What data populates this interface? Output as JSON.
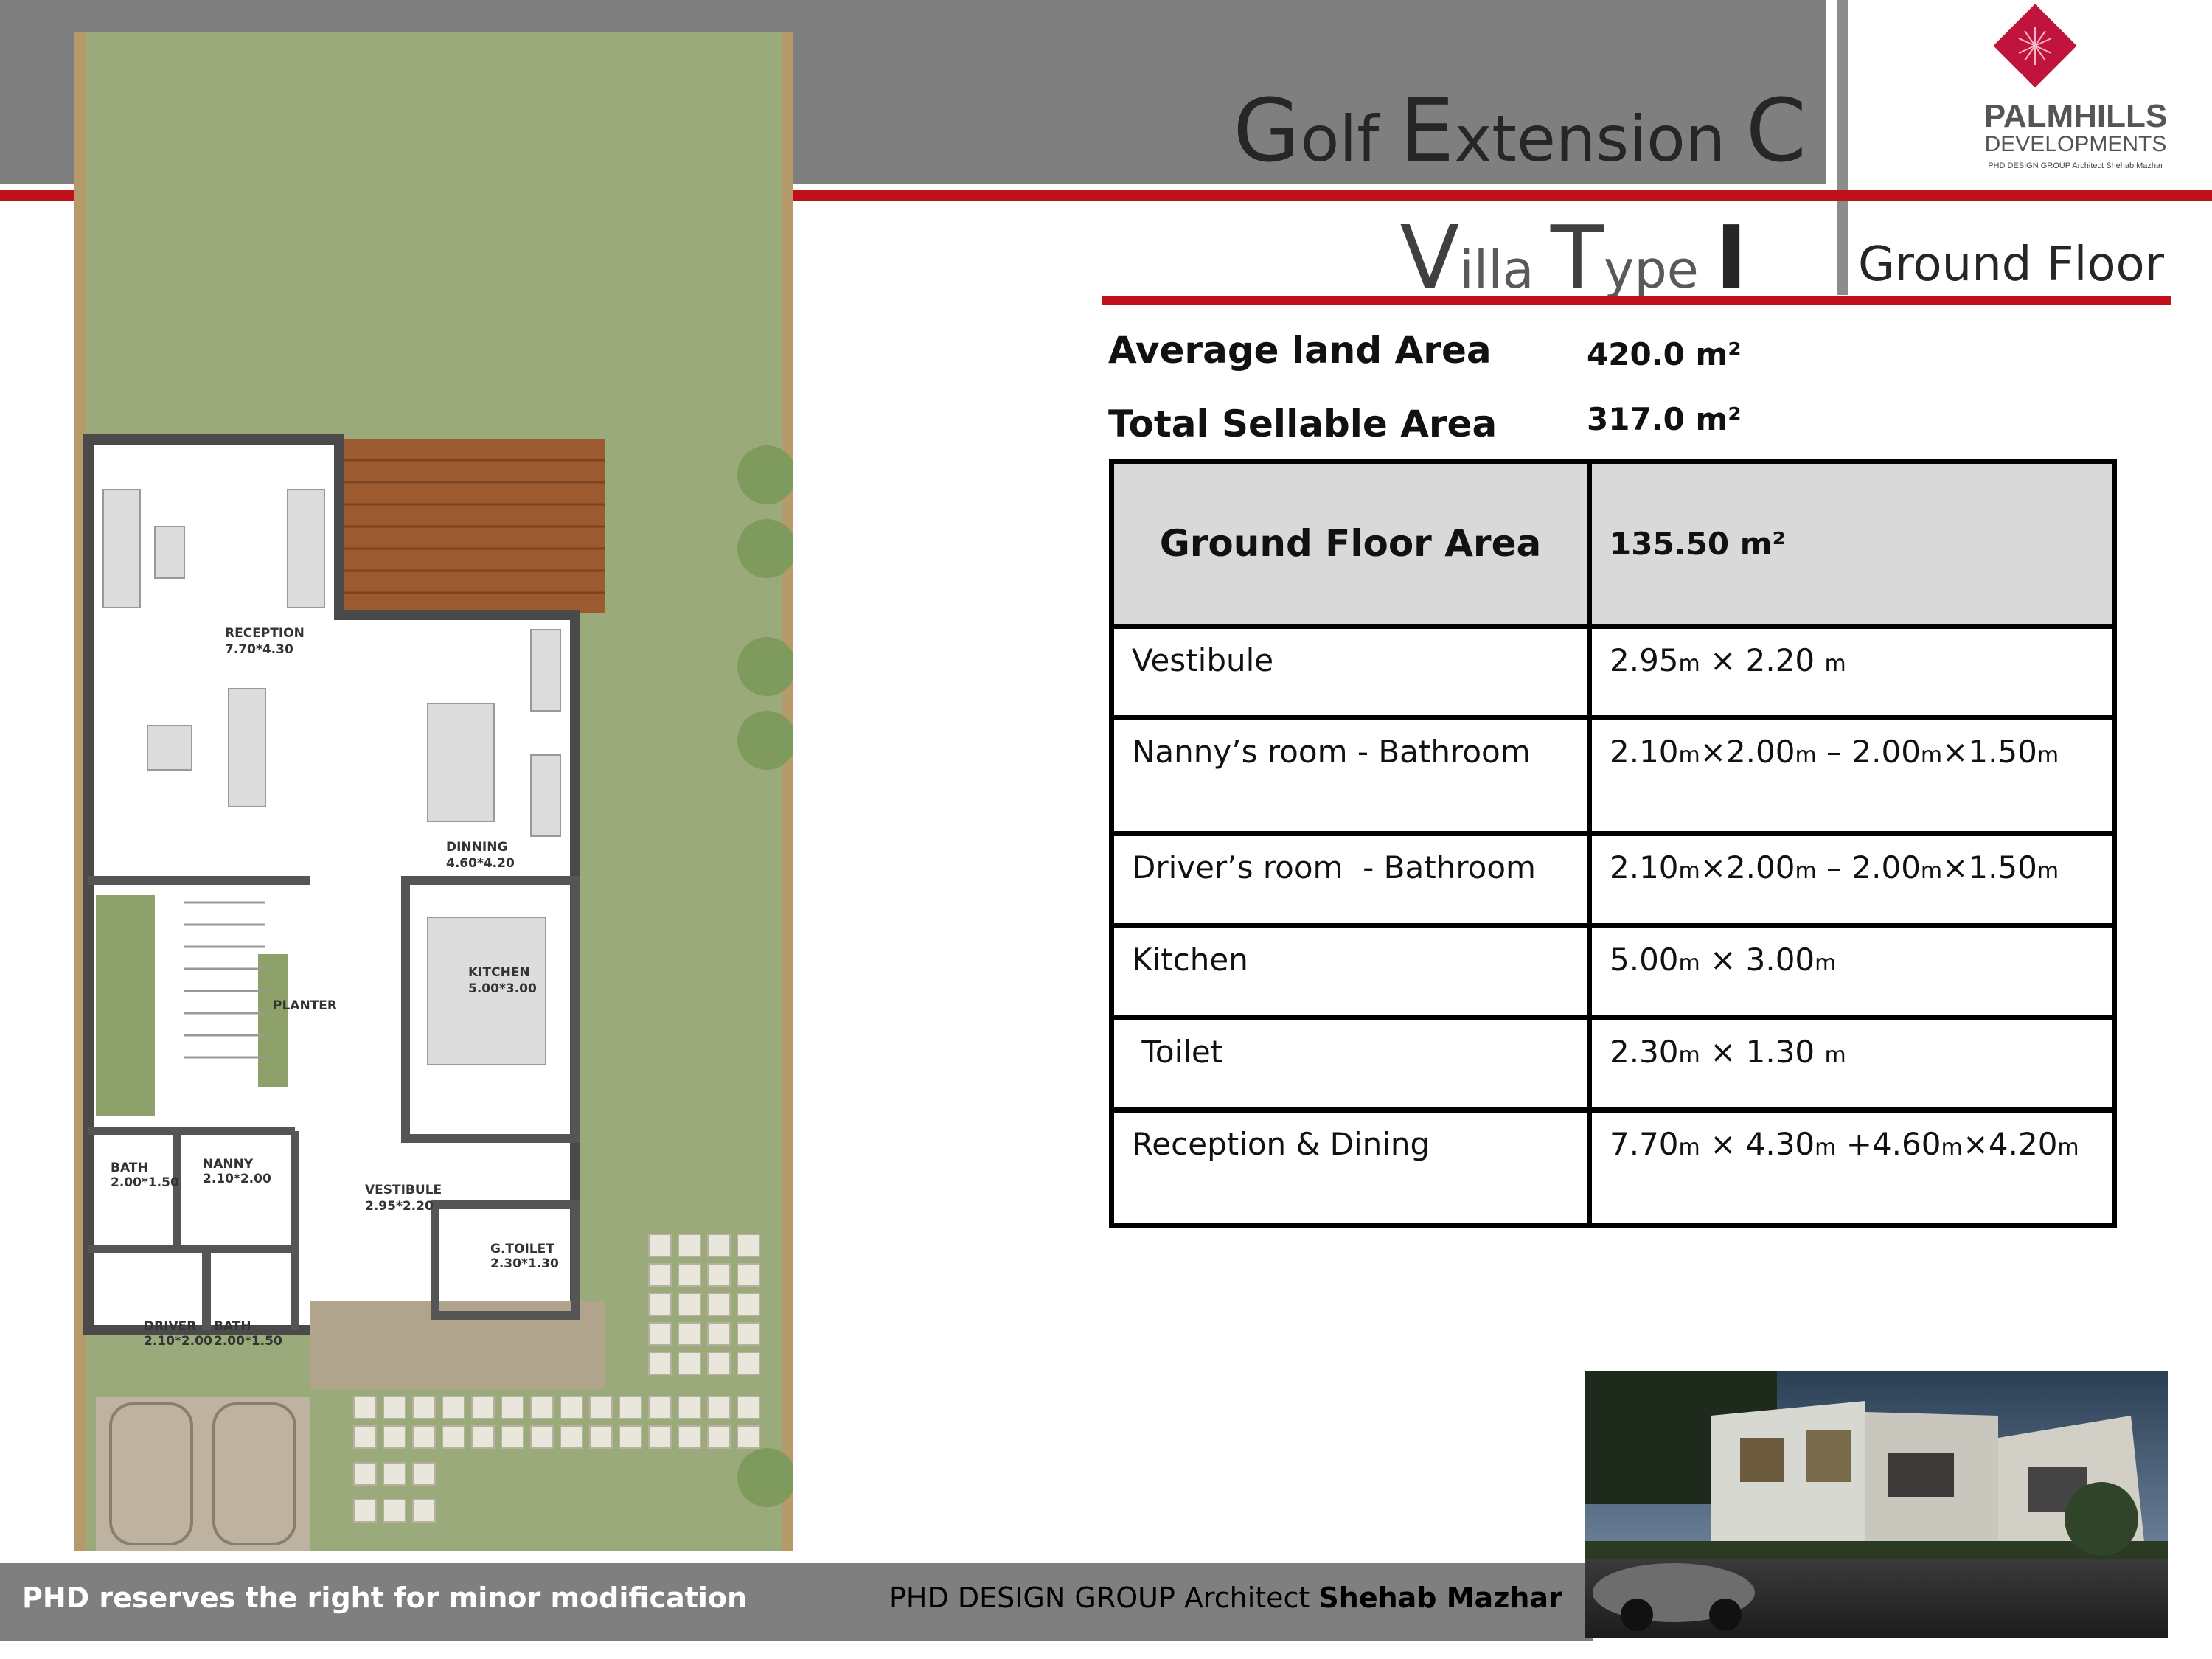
{
  "header": {
    "title_parts": [
      {
        "cap": "G",
        "rest": "olf "
      },
      {
        "cap": "E",
        "rest": "xtension "
      },
      {
        "cap": "C",
        "rest": ""
      }
    ],
    "subtitle_parts": [
      {
        "cap": "V",
        "rest": "illa "
      },
      {
        "cap": "T",
        "rest": "ype "
      },
      {
        "cap": "I",
        "rest": ""
      }
    ],
    "floor_label": "Ground Floor"
  },
  "logo": {
    "brand_line1": "PALMHILLS",
    "brand_line2": "DEVELOPMENTS",
    "tagline": "PHD DESIGN GROUP  Architect Shehab Mazhar",
    "colors": {
      "diamond": "#c0143c",
      "text": "#555555"
    }
  },
  "summary": {
    "land_label": "Average land Area",
    "land_value": "420.0 m²",
    "sellable_label": "Total Sellable Area",
    "sellable_value": "317.0 m²"
  },
  "table": {
    "header_label": "Ground Floor Area",
    "header_value": "135.50 m²",
    "rows": [
      {
        "room": "Vestibule",
        "size": [
          [
            "2.95",
            ""
          ],
          [
            "m",
            " u"
          ],
          [
            " × 2.20 ",
            ""
          ],
          [
            "m",
            " u"
          ]
        ]
      },
      {
        "room": "Nanny’s room - Bathroom",
        "size": [
          [
            "2.10",
            ""
          ],
          [
            "m",
            "u"
          ],
          [
            "×2.00",
            ""
          ],
          [
            "m",
            "u"
          ],
          [
            " – 2.00",
            ""
          ],
          [
            "m",
            "u"
          ],
          [
            "×1.50",
            ""
          ],
          [
            "m",
            "u"
          ]
        ]
      },
      {
        "room": "Driver’s room  - Bathroom",
        "size": [
          [
            "2.10",
            ""
          ],
          [
            "m",
            "u"
          ],
          [
            "×2.00",
            ""
          ],
          [
            "m",
            "u"
          ],
          [
            " – 2.00",
            ""
          ],
          [
            "m",
            "u"
          ],
          [
            "×1.50",
            ""
          ],
          [
            "m",
            "u"
          ]
        ]
      },
      {
        "room": "Kitchen",
        "size": [
          [
            "5.00",
            ""
          ],
          [
            "m",
            "u"
          ],
          [
            " × 3.00",
            ""
          ],
          [
            "m",
            "u"
          ]
        ]
      },
      {
        "room": " Toilet",
        "size": [
          [
            "2.30",
            ""
          ],
          [
            "m",
            "u"
          ],
          [
            " × 1.30 ",
            ""
          ],
          [
            "m",
            "u"
          ]
        ]
      },
      {
        "room": "Reception & Dining",
        "size": [
          [
            "7.70",
            ""
          ],
          [
            "m",
            "u"
          ],
          [
            " × 4.30",
            ""
          ],
          [
            "m",
            "u"
          ],
          [
            " +4.60",
            ""
          ],
          [
            "m",
            "u"
          ],
          [
            "×4.20",
            ""
          ],
          [
            "m",
            "u"
          ]
        ]
      }
    ]
  },
  "plan_labels": {
    "reception": "RECEPTION",
    "reception_size": "7.70*4.30",
    "dinning": "DINNING",
    "dinning_size": "4.60*4.20",
    "kitchen": "KITCHEN",
    "kitchen_size": "5.00*3.00",
    "planter": "PLANTER",
    "bath1": "BATH",
    "bath1_size": "2.00*1.50",
    "nanny": "NANNY",
    "nanny_size": "2.10*2.00",
    "vestibule": "VESTIBULE",
    "vestibule_size": "2.95*2.20",
    "gtoilet": "G.TOILET",
    "gtoilet_size": "2.30*1.30",
    "driver": "DRIVER",
    "driver_size": "2.10*2.00",
    "bath2": "BATH",
    "bath2_size": "2.00*1.50"
  },
  "footer": {
    "left_text": "PHD reserves the right for minor modification",
    "mid_prefix": "PHD DESIGN GROUP",
    "mid_architect": " Architect ",
    "mid_name": "Shehab Mazhar"
  },
  "colors": {
    "accent_red": "#c0111a",
    "header_grey": "#7f7f7f",
    "lawn_green": "#9aaa7a",
    "table_header_bg": "#d9d9d9"
  }
}
